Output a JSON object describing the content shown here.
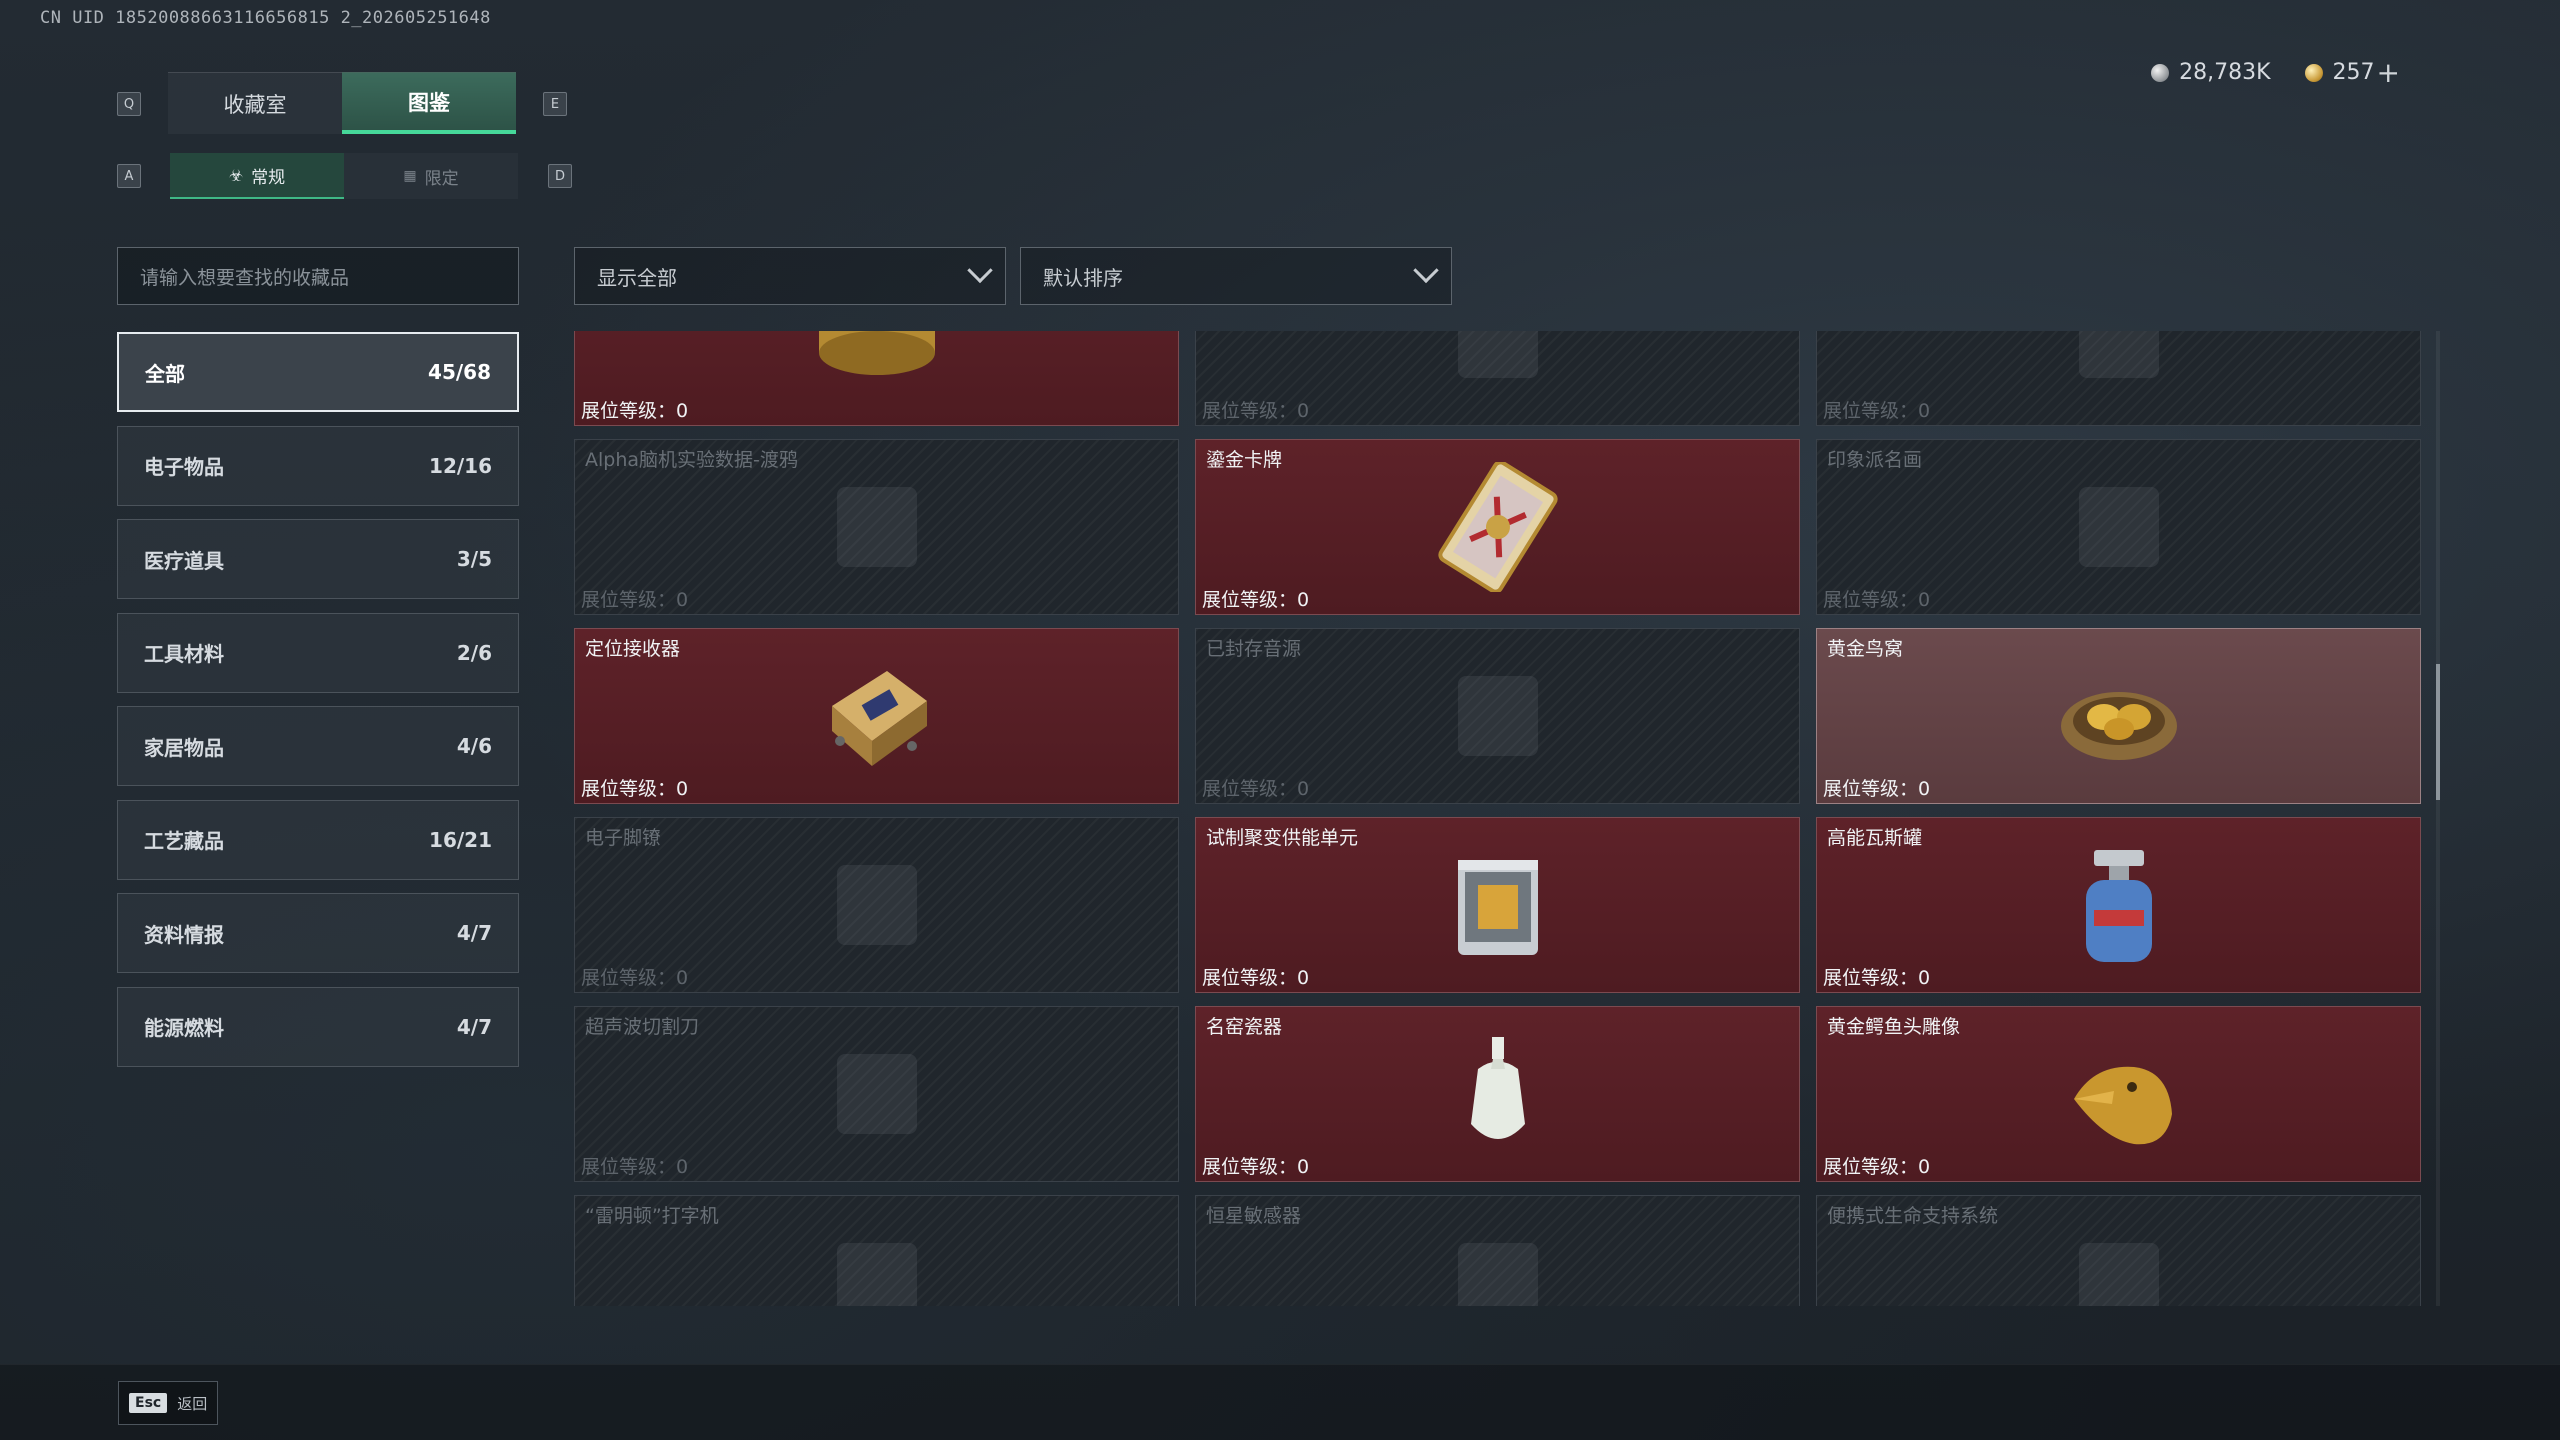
{
  "uid": "CN UID 18520088663116656815 2_202605251648",
  "keys": {
    "prev_tab": "Q",
    "next_tab": "E",
    "prev_sub": "A",
    "next_sub": "D"
  },
  "tabs": {
    "collection": "收藏室",
    "catalog": "图鉴"
  },
  "subtabs": {
    "regular": "常规",
    "limited": "限定"
  },
  "currency": {
    "silver": "28,783K",
    "gold": "257",
    "add": "+"
  },
  "search": {
    "placeholder": "请输入想要查找的收藏品"
  },
  "filter": {
    "show": "显示全部",
    "sort": "默认排序"
  },
  "categories": [
    {
      "name": "全部",
      "count": "45/68"
    },
    {
      "name": "电子物品",
      "count": "12/16"
    },
    {
      "name": "医疗道具",
      "count": "3/5"
    },
    {
      "name": "工具材料",
      "count": "2/6"
    },
    {
      "name": "家居物品",
      "count": "4/6"
    },
    {
      "name": "工艺藏品",
      "count": "16/21"
    },
    {
      "name": "资料情报",
      "count": "4/7"
    },
    {
      "name": "能源燃料",
      "count": "4/7"
    }
  ],
  "level_label": "展位等级：",
  "items": [
    {
      "name": "",
      "level": "0",
      "owned": true,
      "icon": "caviar-tin-icon"
    },
    {
      "name": "",
      "level": "0",
      "owned": false,
      "icon": "item-silhouette-icon"
    },
    {
      "name": "",
      "level": "0",
      "owned": false,
      "icon": "item-silhouette-icon"
    },
    {
      "name": "Alpha脑机实验数据-渡鸦",
      "level": "0",
      "owned": false,
      "icon": "drive-icon"
    },
    {
      "name": "鎏金卡牌",
      "level": "0",
      "owned": true,
      "icon": "gilded-card-icon"
    },
    {
      "name": "印象派名画",
      "level": "0",
      "owned": false,
      "icon": "painting-icon"
    },
    {
      "name": "定位接收器",
      "level": "0",
      "owned": true,
      "icon": "receiver-icon"
    },
    {
      "name": "已封存音源",
      "level": "0",
      "owned": false,
      "icon": "box-icon"
    },
    {
      "name": "黄金鸟窝",
      "level": "0",
      "owned": true,
      "icon": "golden-nest-icon"
    },
    {
      "name": "电子脚镣",
      "level": "0",
      "owned": false,
      "icon": "shackle-icon"
    },
    {
      "name": "试制聚变供能单元",
      "level": "0",
      "owned": true,
      "icon": "fusion-unit-icon"
    },
    {
      "name": "高能瓦斯罐",
      "level": "0",
      "owned": true,
      "icon": "gas-canister-icon"
    },
    {
      "name": "超声波切割刀",
      "level": "0",
      "owned": false,
      "icon": "cutter-icon"
    },
    {
      "name": "名窑瓷器",
      "level": "0",
      "owned": true,
      "icon": "porcelain-vase-icon"
    },
    {
      "name": "黄金鳄鱼头雕像",
      "level": "0",
      "owned": true,
      "icon": "golden-crocodile-icon"
    },
    {
      "name": "“雷明顿”打字机",
      "level": "",
      "owned": false,
      "icon": "typewriter-icon"
    },
    {
      "name": "恒星敏感器",
      "level": "",
      "owned": false,
      "icon": "sensor-icon"
    },
    {
      "name": "便携式生命支持系统",
      "level": "",
      "owned": false,
      "icon": "life-support-icon"
    }
  ],
  "footer": {
    "esc_key": "Esc",
    "back": "返回"
  }
}
